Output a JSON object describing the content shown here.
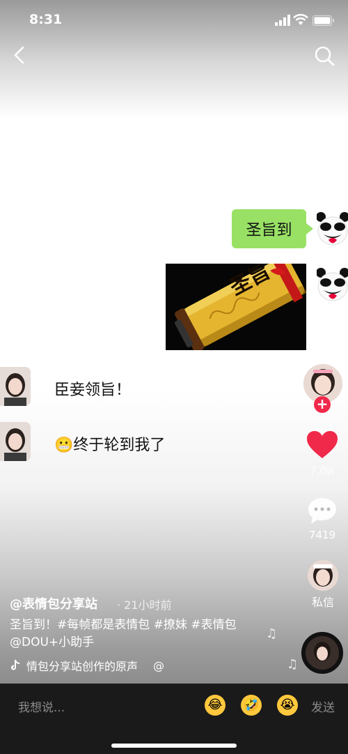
{
  "status_bar": {
    "time": "8:31"
  },
  "chat": {
    "green_bubble": "圣旨到",
    "scroll_text": "圣旨",
    "reply_1": "臣妾领旨！",
    "reply_2": "终于轮到我了",
    "reply_2_emoji": "😬"
  },
  "sidebar": {
    "follow_plus": "+",
    "like_count": "7.0w",
    "comment_count": "7419",
    "dm_label": "私信"
  },
  "post": {
    "author": "@表情包分享站",
    "time": "· 21小时前",
    "description": "圣旨到！#每帧都是表情包 #撩妹 #表情包 @DOU+小助手",
    "music": "情包分享站创作的原声",
    "music_at": "@"
  },
  "bottom_bar": {
    "input_placeholder": "我想说...",
    "emojis": [
      "😂",
      "🤣",
      "😭"
    ],
    "send_label": "发送"
  },
  "colors": {
    "bubble_green": "#98e165",
    "like_red": "#f0294a",
    "bottom_bg": "#1a1a1a"
  }
}
